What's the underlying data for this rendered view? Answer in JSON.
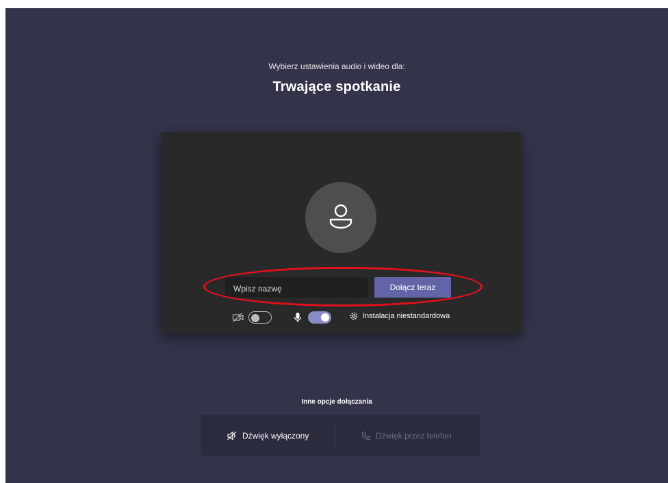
{
  "header": {
    "subtitle": "Wybierz ustawienia audio i wideo dla:",
    "title": "Trwające spotkanie"
  },
  "preview": {
    "avatar_icon": "person-icon",
    "name_input": {
      "placeholder": "Wpisz nazwę",
      "value": ""
    },
    "join_button": "Dołącz teraz",
    "controls": {
      "camera": {
        "icon": "camera-off-icon",
        "enabled": false
      },
      "microphone": {
        "icon": "microphone-icon",
        "enabled": true
      },
      "custom_setup": {
        "icon": "gear-icon",
        "label": "Instalacja niestandardowa"
      }
    }
  },
  "other_options": {
    "title": "Inne opcje dołączania",
    "items": [
      {
        "label": "Dźwięk wyłączony",
        "icon": "speaker-off-icon",
        "enabled": true
      },
      {
        "label": "Dźwięk przez telefon",
        "icon": "phone-icon",
        "enabled": false
      }
    ]
  },
  "colors": {
    "background": "#33344a",
    "preview_bg": "#292929",
    "accent": "#6264a7",
    "toggle_on": "#8b8cc7",
    "annotation": "#e3101c"
  }
}
